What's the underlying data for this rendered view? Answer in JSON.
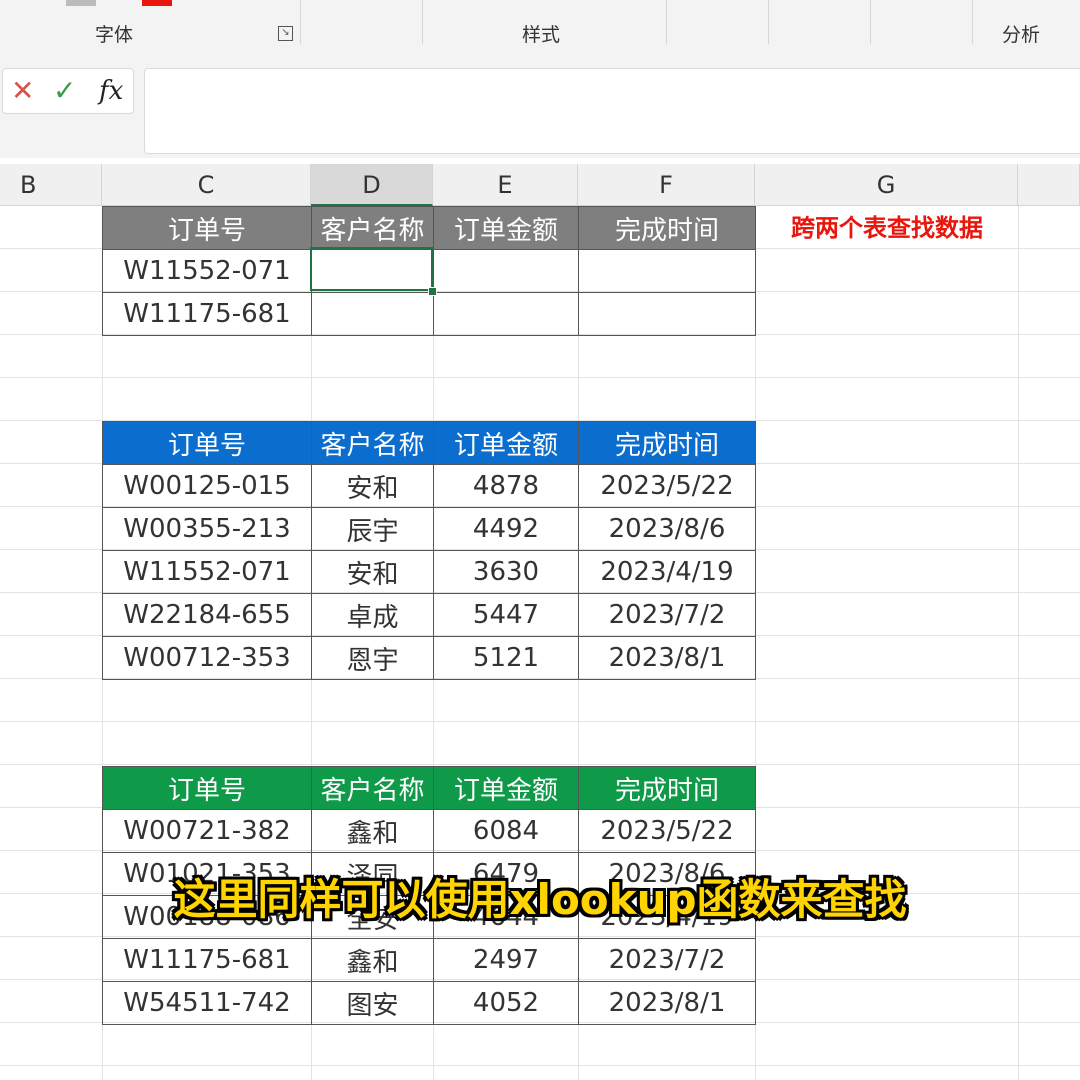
{
  "ribbon": {
    "groups": [
      {
        "label": "字体"
      },
      {
        "label": "样式"
      },
      {
        "label": "分析"
      }
    ]
  },
  "formula_bar": {
    "cancel_icon": "✕",
    "enter_icon": "✓",
    "fx_label": "fx",
    "value": ""
  },
  "columns": [
    "B",
    "C",
    "D",
    "E",
    "F",
    "G"
  ],
  "active_column": "D",
  "note": "跨两个表查找数据",
  "tables": [
    {
      "header_color": "#7f7f7f",
      "headers": [
        "订单号",
        "客户名称",
        "订单金额",
        "完成时间"
      ],
      "rows": [
        [
          "W11552-071",
          "",
          "",
          ""
        ],
        [
          "W11175-681",
          "",
          "",
          ""
        ]
      ]
    },
    {
      "header_color": "#0b6ecf",
      "headers": [
        "订单号",
        "客户名称",
        "订单金额",
        "完成时间"
      ],
      "rows": [
        [
          "W00125-015",
          "安和",
          "4878",
          "2023/5/22"
        ],
        [
          "W00355-213",
          "辰宇",
          "4492",
          "2023/8/6"
        ],
        [
          "W11552-071",
          "安和",
          "3630",
          "2023/4/19"
        ],
        [
          "W22184-655",
          "卓成",
          "5447",
          "2023/7/2"
        ],
        [
          "W00712-353",
          "恩宇",
          "5121",
          "2023/8/1"
        ]
      ]
    },
    {
      "header_color": "#0e9a48",
      "headers": [
        "订单号",
        "客户名称",
        "订单金额",
        "完成时间"
      ],
      "rows": [
        [
          "W00721-382",
          "鑫和",
          "6084",
          "2023/5/22"
        ],
        [
          "W01021-353",
          "泽同",
          "6479",
          "2023/8/6"
        ],
        [
          "W00188-086",
          "全安",
          "4644",
          "2023/4/19"
        ],
        [
          "W11175-681",
          "鑫和",
          "2497",
          "2023/7/2"
        ],
        [
          "W54511-742",
          "图安",
          "4052",
          "2023/8/1"
        ]
      ]
    }
  ],
  "subtitle": "这里同样可以使用xlookup函数来查找"
}
